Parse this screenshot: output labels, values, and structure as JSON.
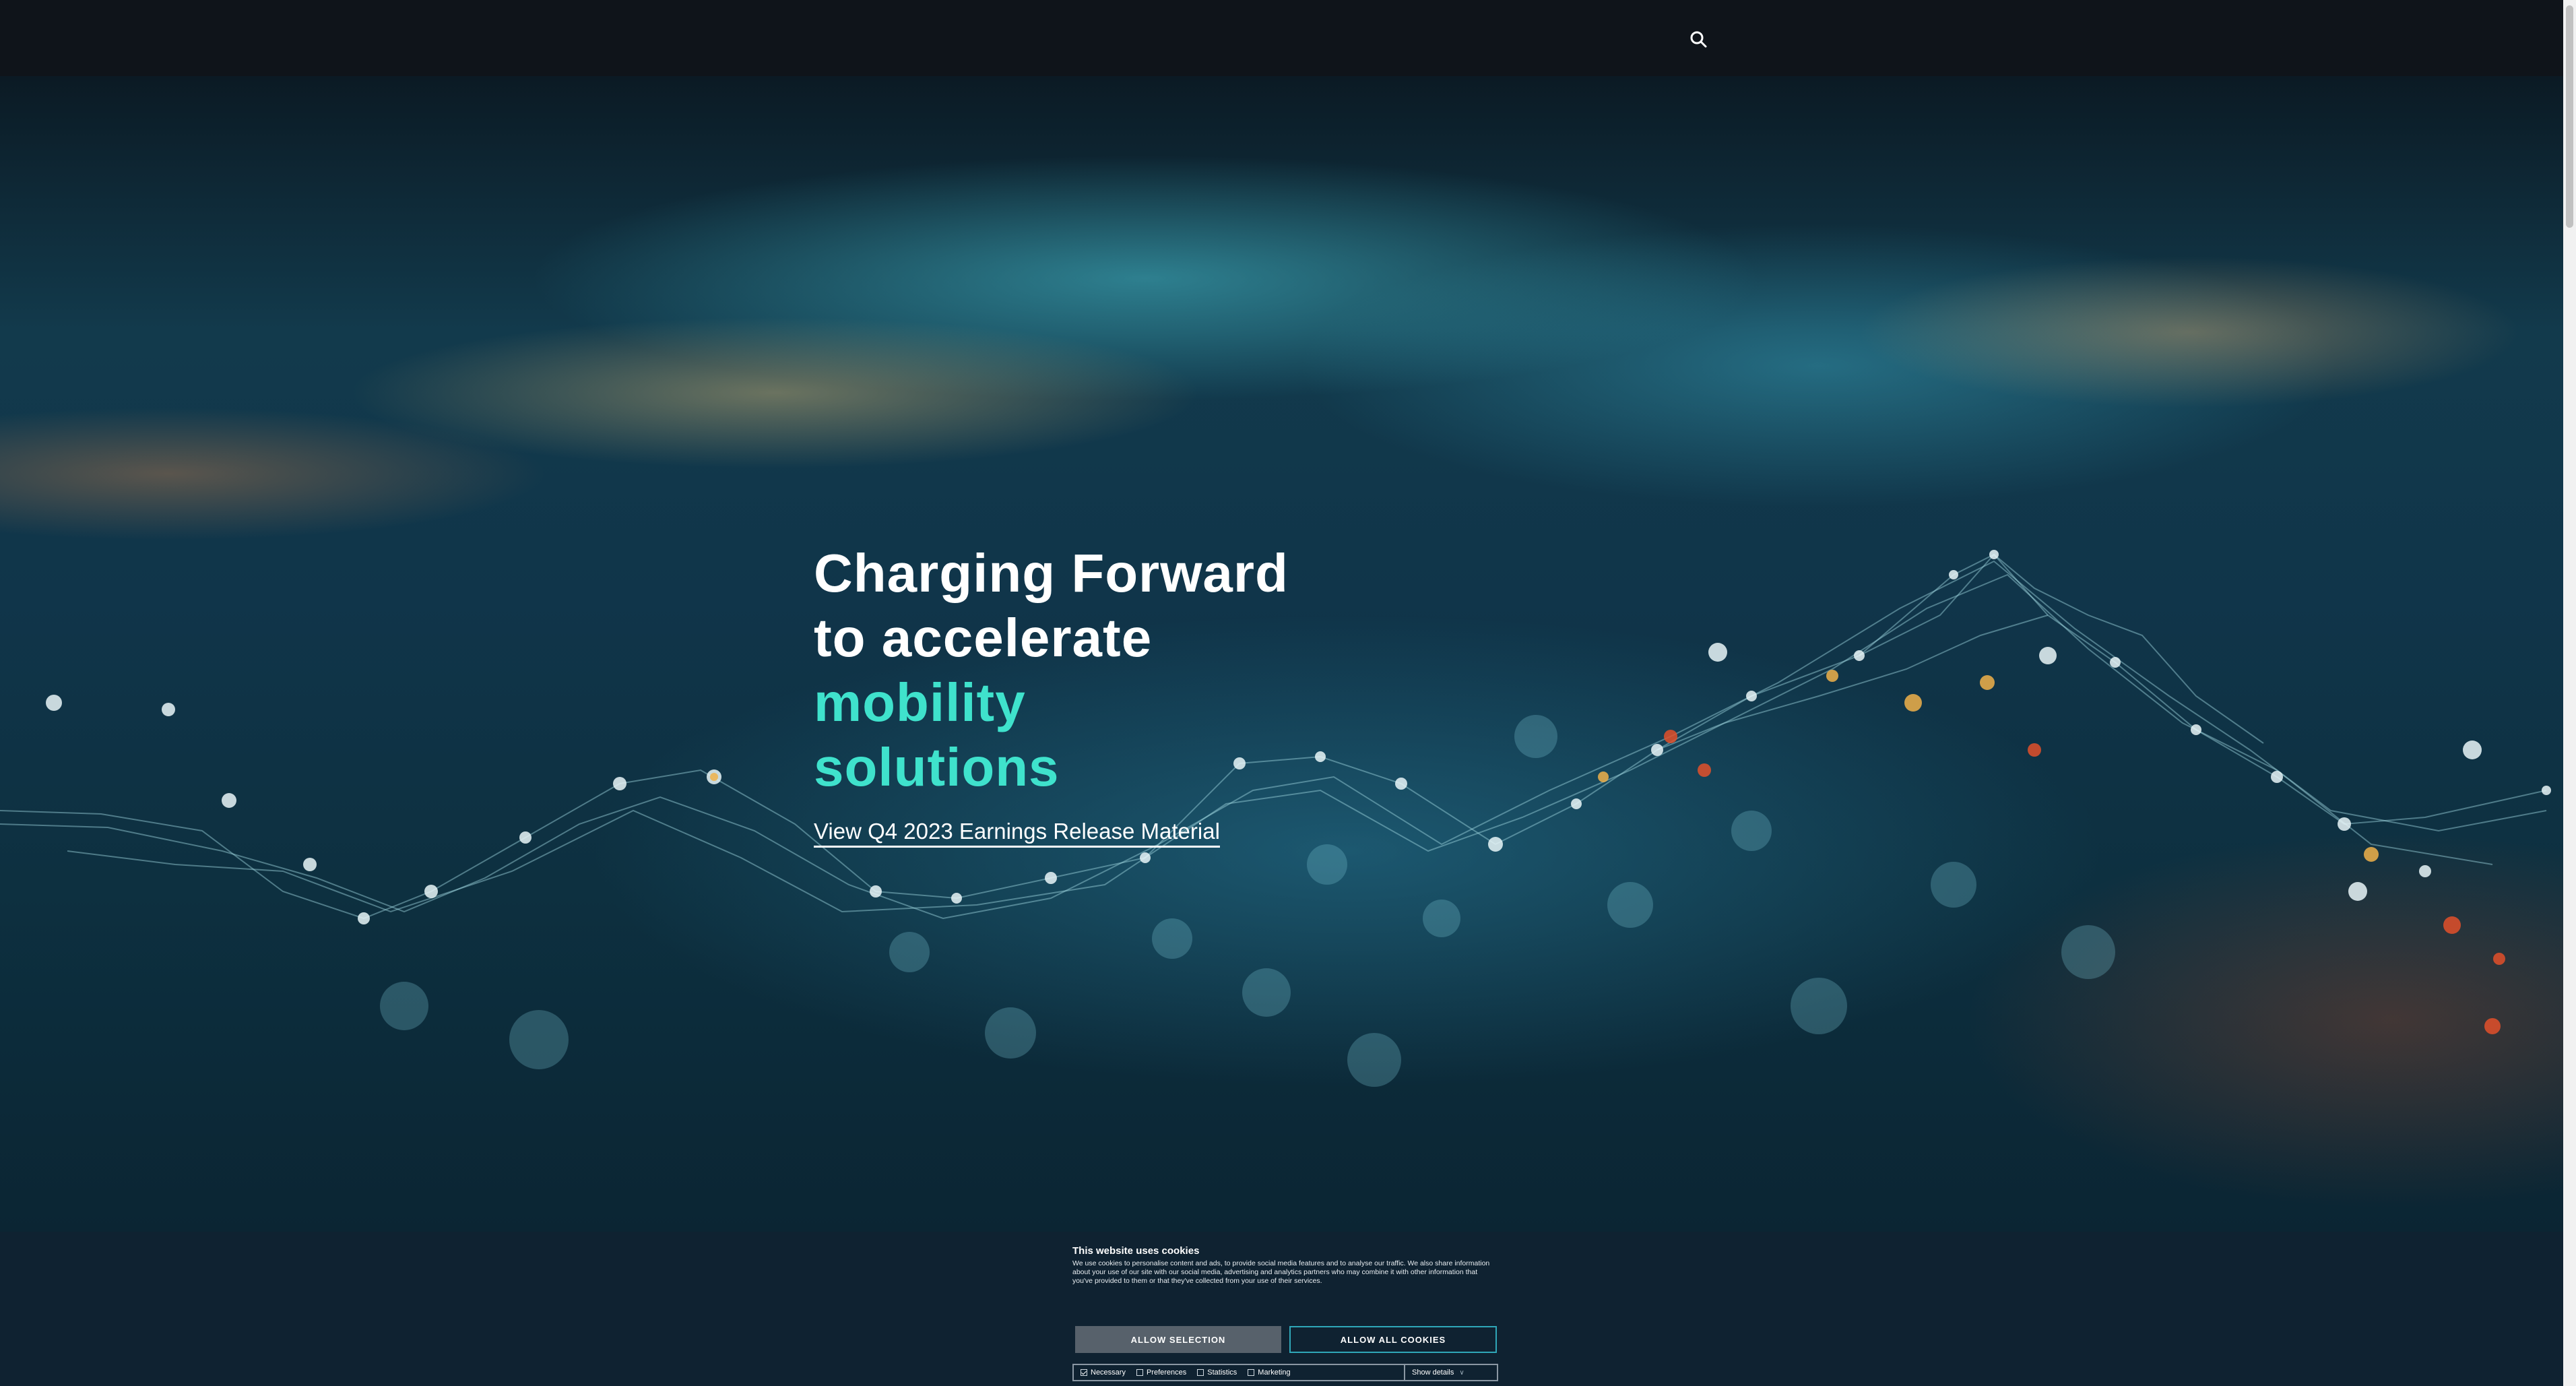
{
  "header": {
    "search_icon": "search-icon"
  },
  "hero": {
    "headline_line1": "Charging Forward",
    "headline_line2": "to accelerate",
    "headline_accent1": "mobility",
    "headline_accent2": "solutions",
    "link_label": "View Q4 2023 Earnings Release Material",
    "accent_color": "#3fe2cc"
  },
  "cookie": {
    "title": "This website uses cookies",
    "body": "We use cookies to personalise content and ads, to provide social media features and to analyse our traffic. We also share information about your use of our site with our social media, advertising and analytics partners who may combine it with other information that you've provided to them or that they've collected from your use of their services.",
    "allow_selection_label": "ALLOW SELECTION",
    "allow_all_label": "ALLOW ALL COOKIES",
    "options": [
      {
        "label": "Necessary",
        "checked": true
      },
      {
        "label": "Preferences",
        "checked": false
      },
      {
        "label": "Statistics",
        "checked": false
      },
      {
        "label": "Marketing",
        "checked": false
      }
    ],
    "show_details_label": "Show details"
  }
}
